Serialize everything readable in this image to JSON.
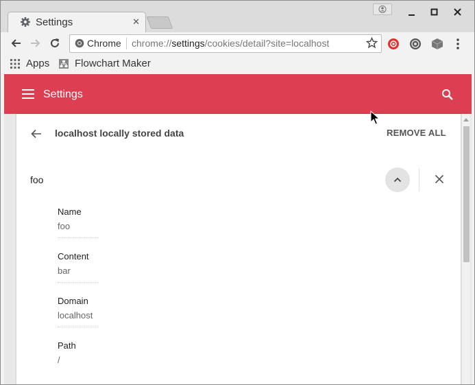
{
  "browser": {
    "tab": {
      "title": "Settings",
      "favicon": "gear-icon",
      "close": "✕"
    },
    "toolbar": {
      "security_chip_label": "Chrome",
      "url_scheme": "chrome://",
      "url_host": "settings",
      "url_path": "/cookies/detail?site=localhost"
    },
    "bookmarks": [
      {
        "label": "Apps",
        "icon": "apps-grid-icon"
      },
      {
        "label": "Flowchart Maker",
        "icon": "flowchart-icon"
      }
    ]
  },
  "settings": {
    "appbar_title": "Settings",
    "accent_color": "#dc3f52",
    "detail_title": "localhost locally stored data",
    "remove_all_label": "REMOVE ALL",
    "cookie": {
      "name": "foo",
      "fields": [
        {
          "label": "Name",
          "value": "foo"
        },
        {
          "label": "Content",
          "value": "bar"
        },
        {
          "label": "Domain",
          "value": "localhost"
        },
        {
          "label": "Path",
          "value": "/"
        }
      ]
    }
  }
}
